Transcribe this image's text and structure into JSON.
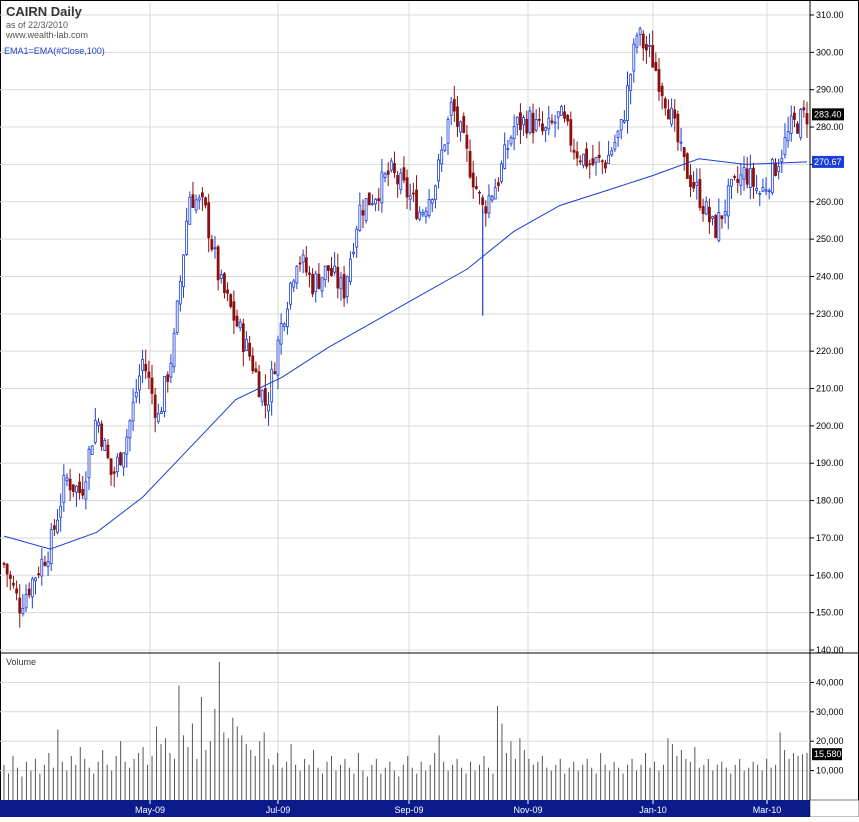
{
  "header": {
    "title": "CAIRN Daily",
    "as_of": "as of 22/3/2010",
    "source": "www.wealth-lab.com",
    "indicator": "EMA1=EMA(#Close,100)"
  },
  "colors": {
    "up_candle": "#1a3ed6",
    "down_candle": "#8b1010",
    "ema_line": "#1a3ed6",
    "volume_bar": "#555555",
    "grid": "#d9d9d9",
    "axis_bar": "#0b1b8c"
  },
  "chart_data": [
    {
      "type": "candlestick",
      "title": "CAIRN Daily",
      "ylim": [
        140,
        315
      ],
      "y_ticks": [
        "140.00",
        "150.00",
        "160.00",
        "170.00",
        "180.00",
        "190.00",
        "200.00",
        "210.00",
        "220.00",
        "230.00",
        "240.00",
        "250.00",
        "260.00",
        "270.00",
        "280.00",
        "290.00",
        "300.00",
        "310.00"
      ],
      "x_ticks": [
        "May-09",
        "Jul-09",
        "Sep-09",
        "Nov-09",
        "Jan-10",
        "Mar-10"
      ],
      "grid": true,
      "close_path": [
        {
          "date": "2009-03-23",
          "close": 163
        },
        {
          "date": "2009-03-30",
          "close": 152
        },
        {
          "date": "2009-04-06",
          "close": 160
        },
        {
          "date": "2009-04-13",
          "close": 168
        },
        {
          "date": "2009-04-20",
          "close": 186
        },
        {
          "date": "2009-04-27",
          "close": 182
        },
        {
          "date": "2009-05-04",
          "close": 203
        },
        {
          "date": "2009-05-11",
          "close": 186
        },
        {
          "date": "2009-05-18",
          "close": 198
        },
        {
          "date": "2009-05-25",
          "close": 218
        },
        {
          "date": "2009-06-01",
          "close": 202
        },
        {
          "date": "2009-06-08",
          "close": 222
        },
        {
          "date": "2009-06-15",
          "close": 262
        },
        {
          "date": "2009-06-22",
          "close": 258
        },
        {
          "date": "2009-06-29",
          "close": 238
        },
        {
          "date": "2009-07-06",
          "close": 228
        },
        {
          "date": "2009-07-13",
          "close": 218
        },
        {
          "date": "2009-07-20",
          "close": 205
        },
        {
          "date": "2009-07-27",
          "close": 228
        },
        {
          "date": "2009-08-03",
          "close": 246
        },
        {
          "date": "2009-08-10",
          "close": 238
        },
        {
          "date": "2009-08-17",
          "close": 242
        },
        {
          "date": "2009-08-24",
          "close": 236
        },
        {
          "date": "2009-08-31",
          "close": 258
        },
        {
          "date": "2009-09-07",
          "close": 262
        },
        {
          "date": "2009-09-14",
          "close": 268
        },
        {
          "date": "2009-09-21",
          "close": 263
        },
        {
          "date": "2009-09-28",
          "close": 257
        },
        {
          "date": "2009-10-05",
          "close": 266
        },
        {
          "date": "2009-10-12",
          "close": 286
        },
        {
          "date": "2009-10-19",
          "close": 272
        },
        {
          "date": "2009-10-26",
          "close": 258
        },
        {
          "date": "2009-11-02",
          "close": 266
        },
        {
          "date": "2009-11-09",
          "close": 280
        },
        {
          "date": "2009-11-16",
          "close": 282
        },
        {
          "date": "2009-11-23",
          "close": 278
        },
        {
          "date": "2009-11-30",
          "close": 283
        },
        {
          "date": "2009-12-07",
          "close": 274
        },
        {
          "date": "2009-12-14",
          "close": 270
        },
        {
          "date": "2009-12-21",
          "close": 271
        },
        {
          "date": "2009-12-28",
          "close": 280
        },
        {
          "date": "2010-01-04",
          "close": 305
        },
        {
          "date": "2010-01-11",
          "close": 298
        },
        {
          "date": "2010-01-18",
          "close": 286
        },
        {
          "date": "2010-01-25",
          "close": 270
        },
        {
          "date": "2010-02-01",
          "close": 262
        },
        {
          "date": "2010-02-08",
          "close": 252
        },
        {
          "date": "2010-02-15",
          "close": 262
        },
        {
          "date": "2010-02-22",
          "close": 268
        },
        {
          "date": "2010-03-01",
          "close": 262
        },
        {
          "date": "2010-03-08",
          "close": 270
        },
        {
          "date": "2010-03-15",
          "close": 280
        },
        {
          "date": "2010-03-22",
          "close": 283.4
        }
      ],
      "ema_series": {
        "name": "EMA1=EMA(#Close,100)",
        "points": [
          {
            "date": "2009-03-23",
            "value": 170.5
          },
          {
            "date": "2009-04-13",
            "value": 167
          },
          {
            "date": "2009-05-04",
            "value": 171.5
          },
          {
            "date": "2009-05-25",
            "value": 181
          },
          {
            "date": "2009-06-15",
            "value": 194
          },
          {
            "date": "2009-07-06",
            "value": 207
          },
          {
            "date": "2009-07-27",
            "value": 213
          },
          {
            "date": "2009-08-17",
            "value": 221
          },
          {
            "date": "2009-09-07",
            "value": 228
          },
          {
            "date": "2009-09-28",
            "value": 235
          },
          {
            "date": "2009-10-19",
            "value": 242
          },
          {
            "date": "2009-11-09",
            "value": 252
          },
          {
            "date": "2009-11-30",
            "value": 259
          },
          {
            "date": "2009-12-21",
            "value": 263
          },
          {
            "date": "2010-01-11",
            "value": 267
          },
          {
            "date": "2010-02-01",
            "value": 271.5
          },
          {
            "date": "2010-02-22",
            "value": 270
          },
          {
            "date": "2010-03-22",
            "value": 270.67
          }
        ]
      },
      "notable_lows": [
        {
          "date": "2009-10-26",
          "low": 229.5
        }
      ],
      "last_close": "283.40",
      "last_ema": "270.67"
    },
    {
      "type": "bar",
      "title": "Volume",
      "ylim": [
        0,
        50000
      ],
      "y_ticks": [
        "10,000",
        "20,000",
        "30,000",
        "40,000"
      ],
      "values": [
        12000,
        9000,
        15000,
        11000,
        8000,
        13000,
        10000,
        14000,
        9000,
        12000,
        16000,
        11000,
        24000,
        13000,
        10000,
        15000,
        12000,
        18000,
        14000,
        11000,
        9000,
        13000,
        17000,
        12000,
        10000,
        15000,
        20000,
        13000,
        11000,
        14000,
        16000,
        18000,
        12000,
        15000,
        25000,
        19000,
        21000,
        16000,
        14000,
        39000,
        22000,
        18000,
        26000,
        14000,
        35000,
        17000,
        20000,
        31000,
        47000,
        23000,
        21000,
        28000,
        25000,
        22000,
        19000,
        17000,
        15000,
        20000,
        23000,
        14000,
        12000,
        16000,
        11000,
        13000,
        19000,
        12000,
        10000,
        14000,
        12000,
        17000,
        11000,
        9000,
        13000,
        15000,
        10000,
        12000,
        14000,
        11000,
        9000,
        16000,
        10000,
        8000,
        12000,
        14000,
        9000,
        11000,
        13000,
        10000,
        8000,
        12000,
        15000,
        11000,
        9000,
        13000,
        10000,
        12000,
        16000,
        22000,
        13000,
        10000,
        12000,
        14000,
        11000,
        9000,
        13000,
        10000,
        12000,
        15000,
        11000,
        9000,
        32000,
        26000,
        16000,
        20000,
        14000,
        21000,
        17000,
        14000,
        12000,
        13000,
        15000,
        11000,
        10000,
        12000,
        14000,
        9000,
        11000,
        13000,
        10000,
        12000,
        14000,
        11000,
        9000,
        16000,
        12000,
        10000,
        13000,
        11000,
        9000,
        12000,
        14000,
        10000,
        12000,
        16000,
        11000,
        13000,
        10000,
        12000,
        21000,
        19000,
        15000,
        17000,
        14000,
        13000,
        18000,
        11000,
        12000,
        14000,
        10000,
        12000,
        13000,
        11000,
        9000,
        12000,
        14000,
        10000,
        11000,
        13000,
        12000,
        10000,
        14000,
        11000,
        12000,
        23000,
        17000,
        14000,
        16000,
        15000,
        15580,
        16000
      ],
      "last_value": "15,580"
    }
  ]
}
